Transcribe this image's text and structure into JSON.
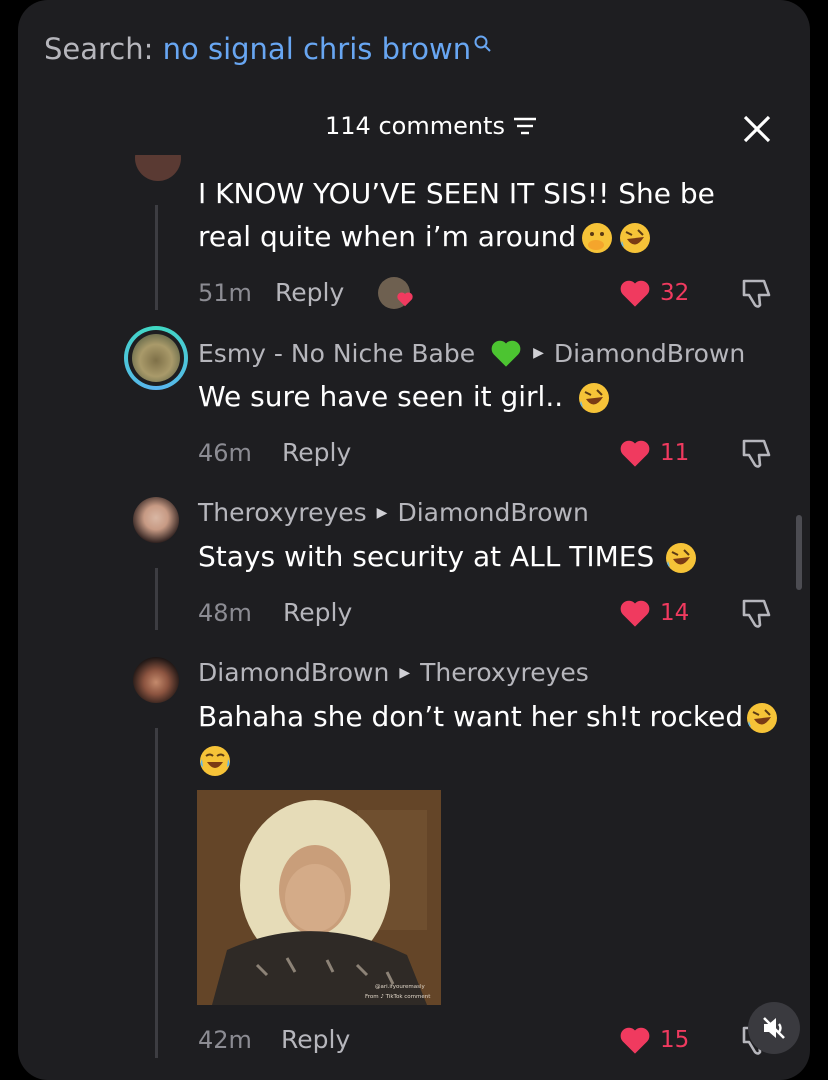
{
  "search": {
    "label": "Search:",
    "query": "no signal chris brown"
  },
  "header": {
    "title": "114 comments"
  },
  "comments": [
    {
      "text_line1": "I KNOW YOU’VE SEEN IT SIS!! She be",
      "text_line2": "real quite when i’m around",
      "time": "51m",
      "reply": "Reply",
      "likes": "32"
    },
    {
      "author": "Esmy - No Niche Babe",
      "reply_to": "DiamondBrown",
      "text": "We sure have seen it girl..",
      "time": "46m",
      "reply": "Reply",
      "likes": "11"
    },
    {
      "author": "Theroxyreyes",
      "reply_to": "DiamondBrown",
      "text": "Stays with security at ALL TIMES",
      "time": "48m",
      "reply": "Reply",
      "likes": "14"
    },
    {
      "author": "DiamondBrown",
      "reply_to": "Theroxyreyes",
      "text": "Bahaha she don’t want her sh!t rocked",
      "gif_watermark_line1": "@ari.ifyouremasly",
      "gif_watermark_line2": "From ♪ TikTok comment",
      "time": "42m",
      "reply": "Reply",
      "likes": "15"
    }
  ],
  "colors": {
    "panel": "#1e1e21",
    "like": "#f03a5f",
    "link": "#68a6f2",
    "muted": "#8c8c93"
  }
}
